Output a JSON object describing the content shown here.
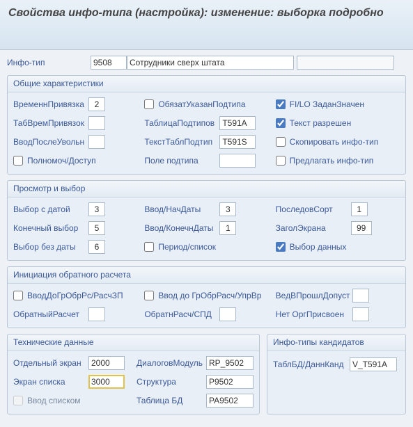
{
  "title": "Свойства инфо-типа (настройка): изменение: выборка подробно",
  "header": {
    "label": "Инфо-тип",
    "code": "9508",
    "name": "Сотрудники сверх штата"
  },
  "groups": {
    "general": {
      "title": "Общие характеристики",
      "time_binding_label": "ВременнПривязка",
      "time_binding": "2",
      "tab_time_label": "ТабВремПривязок",
      "tab_time": "",
      "after_dismiss_label": "ВводПослеУвольн",
      "after_dismiss": "",
      "auth_access_label": "Полномоч/Доступ",
      "auth_access_checked": false,
      "required_subtype_label": "ОбязатУказанПодтипа",
      "required_subtype_checked": false,
      "subtype_table_label": "ТаблицаПодтипов",
      "subtype_table": "T591A",
      "subtype_text_table_label": "ТекстТаблПодтип",
      "subtype_text_table": "T591S",
      "subtype_field_label": "Поле подтипа",
      "subtype_field": "",
      "filo_label": "FI/LO ЗаданЗначен",
      "filo_checked": true,
      "text_allowed_label": "Текст разрешен",
      "text_allowed_checked": true,
      "copy_infotype_label": "Скопировать инфо-тип",
      "copy_infotype_checked": false,
      "suggest_infotype_label": "Предлагать инфо-тип",
      "suggest_infotype_checked": false
    },
    "view": {
      "title": "Просмотр и выбор",
      "sel_date_label": "Выбор с датой",
      "sel_date": "3",
      "end_sel_label": "Конечный выбор",
      "end_sel": "5",
      "no_date_label": "Выбор без даты",
      "no_date": "6",
      "begin_date_label": "Ввод/НачДаты",
      "begin_date": "3",
      "end_date_label": "Ввод/КонечнДаты",
      "end_date": "1",
      "period_list_label": "Период/список",
      "period_list_checked": false,
      "sort_label": "ПоследовСорт",
      "sort": "1",
      "screen_title_label": "ЗаголЭкрана",
      "screen_title": "99",
      "data_select_label": "Выбор данных",
      "data_select_checked": true
    },
    "retro": {
      "title": "Инициация обратного расчета",
      "gr_obr_label": "ВводДоГрОбрРс/РасчЗП",
      "gr_obr": "",
      "retro_label": "ОбратныйРасчет",
      "retro": "",
      "gr_obr2_label": "Ввод до ГрОбрРасч/УпрВр",
      "gr_obr2": "",
      "retro2_label": "ОбратнРасч/СПД",
      "retro2": "",
      "past_label": "ВедВПрошлДопуст",
      "past": "",
      "no_org_label": "Нет ОргПрисвоен",
      "no_org": ""
    },
    "tech": {
      "title": "Технические данные",
      "single_screen_label": "Отдельный экран",
      "single_screen": "2000",
      "list_screen_label": "Экран списка",
      "list_screen": "3000",
      "input_list_label": "Ввод списком",
      "input_list_checked": false,
      "dialog_label": "ДиалоговМодуль",
      "dialog": "RP_9502",
      "struct_label": "Структура",
      "struct": "P9502",
      "dbtab_label": "Таблица БД",
      "dbtab": "PA9502"
    },
    "cand": {
      "title": "Инфо-типы кандидатов",
      "dbtable_label": "ТаблБД/ДаннКанд",
      "dbtable": "V_T591A"
    }
  }
}
